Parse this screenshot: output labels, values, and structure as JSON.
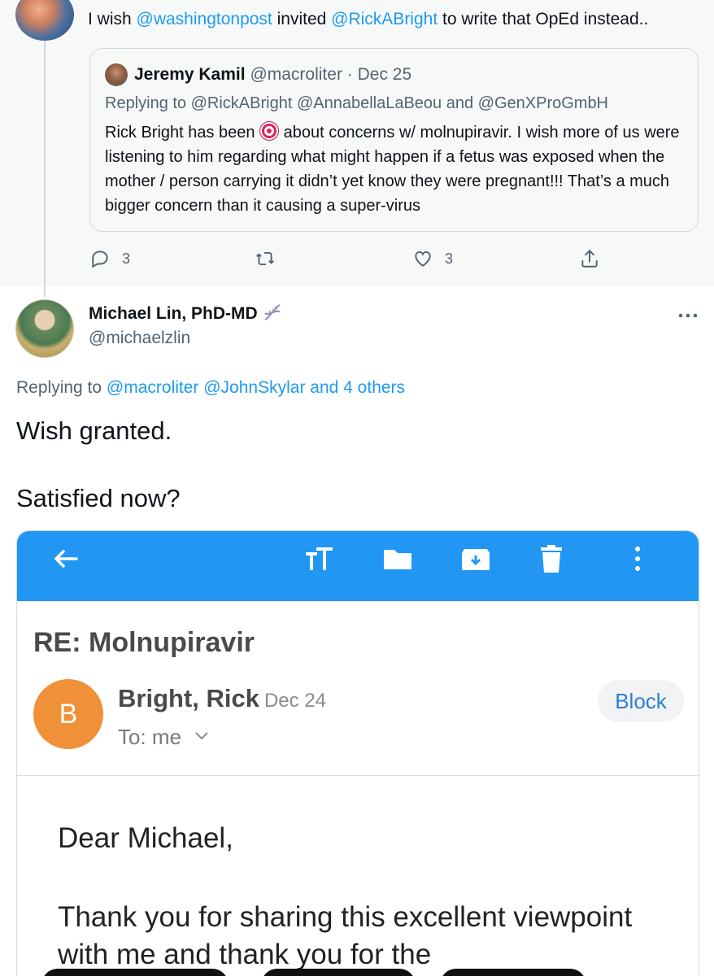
{
  "previous_tweet": {
    "text_prefix": "I wish ",
    "mention1": "@washingtonpost",
    "text_middle": " invited ",
    "mention2": "@RickABright",
    "text_suffix": " to write that OpEd instead.."
  },
  "quoted_tweet": {
    "name": "Jeremy Kamil",
    "handle": "@macroliter",
    "separator": " · ",
    "date": "Dec 25",
    "replying_to": "Replying to @RickABright @AnnabellaLaBeou and @GenXProGmbH",
    "body_before_emoji": "Rick Bright has been ",
    "emoji": "direct-hit-target-emoji",
    "body_after_emoji": " about concerns w/ molnupiravir. I wish more of us were listening to him regarding what might happen if a fetus was exposed when the mother / person carrying it didn’t yet know they were pregnant!!! That’s a much bigger concern than it causing a super-virus"
  },
  "actions": {
    "reply_count": "3",
    "retweet_count": "",
    "like_count": "3"
  },
  "main_tweet": {
    "name": "Michael Lin, PhD-MD",
    "handle": "@michaelzlin",
    "replying_label": "Replying to ",
    "replying_mentions": "@macroliter @JohnSkylar",
    "replying_and": " and ",
    "replying_others": "4 others",
    "line1": "Wish granted.",
    "line2": "Satisfied now?"
  },
  "email": {
    "subject": "RE: Molnupiravir",
    "sender_initial": "B",
    "sender_name": "Bright, Rick",
    "date": "Dec 24",
    "to": "To: me",
    "block_label": "Block",
    "greeting": "Dear Michael,",
    "body": "Thank you for sharing this excellent viewpoint with me and thank you for the",
    "toolbar_color": "#2196f3",
    "avatar_color": "#f0913a"
  },
  "colors": {
    "link": "#1d9bf0",
    "secondary_text": "#536471"
  }
}
